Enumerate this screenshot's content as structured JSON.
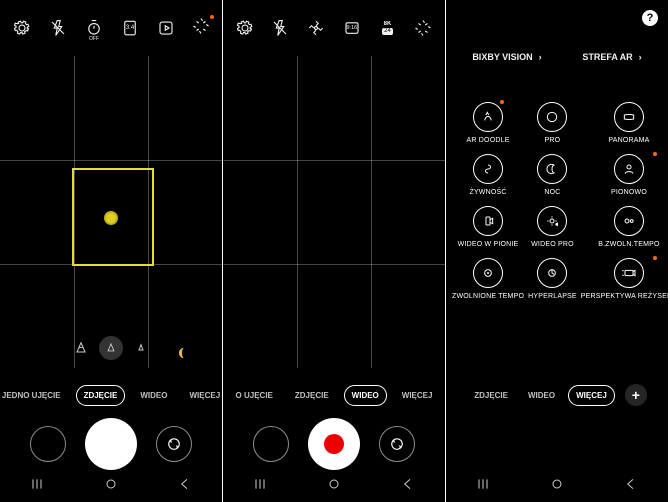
{
  "s1": {
    "top": {
      "timer": "OFF",
      "ratio": "3:4"
    },
    "modes": [
      "JEDNO UJĘCIE",
      "ZDJĘCIE",
      "WIDEO",
      "WIĘCEJ"
    ],
    "active_mode": 1
  },
  "s2": {
    "top": {
      "ratio": "9:16",
      "res": "8K",
      "fps": "24"
    },
    "modes": [
      "O UJĘCIE",
      "ZDJĘCIE",
      "WIDEO",
      "WIĘCEJ"
    ],
    "active_mode": 2
  },
  "s3": {
    "help": "?",
    "links": [
      "BIXBY VISION",
      "STREFA AR"
    ],
    "items": [
      {
        "label": "AR DOODLE",
        "dot": true
      },
      {
        "label": "PRO",
        "dot": false
      },
      {
        "label": "PANORAMA",
        "dot": false
      },
      {
        "label": "ŻYWNOŚĆ",
        "dot": false
      },
      {
        "label": "NOC",
        "dot": false
      },
      {
        "label": "PIONOWO",
        "dot": true
      },
      {
        "label": "WIDEO W PIONIE",
        "dot": false
      },
      {
        "label": "WIDEO PRO",
        "dot": false
      },
      {
        "label": "B.ZWOLN.TEMPO",
        "dot": false
      },
      {
        "label": "ZWOLNIONE TEMPO",
        "dot": false
      },
      {
        "label": "HYPERLAPSE",
        "dot": false
      },
      {
        "label": "PERSPEKTYWA REŻYSERA",
        "dot": true
      }
    ],
    "modes": [
      "ZDJĘCIE",
      "WIDEO",
      "WIĘCEJ"
    ],
    "active_mode": 2,
    "add": "+"
  }
}
